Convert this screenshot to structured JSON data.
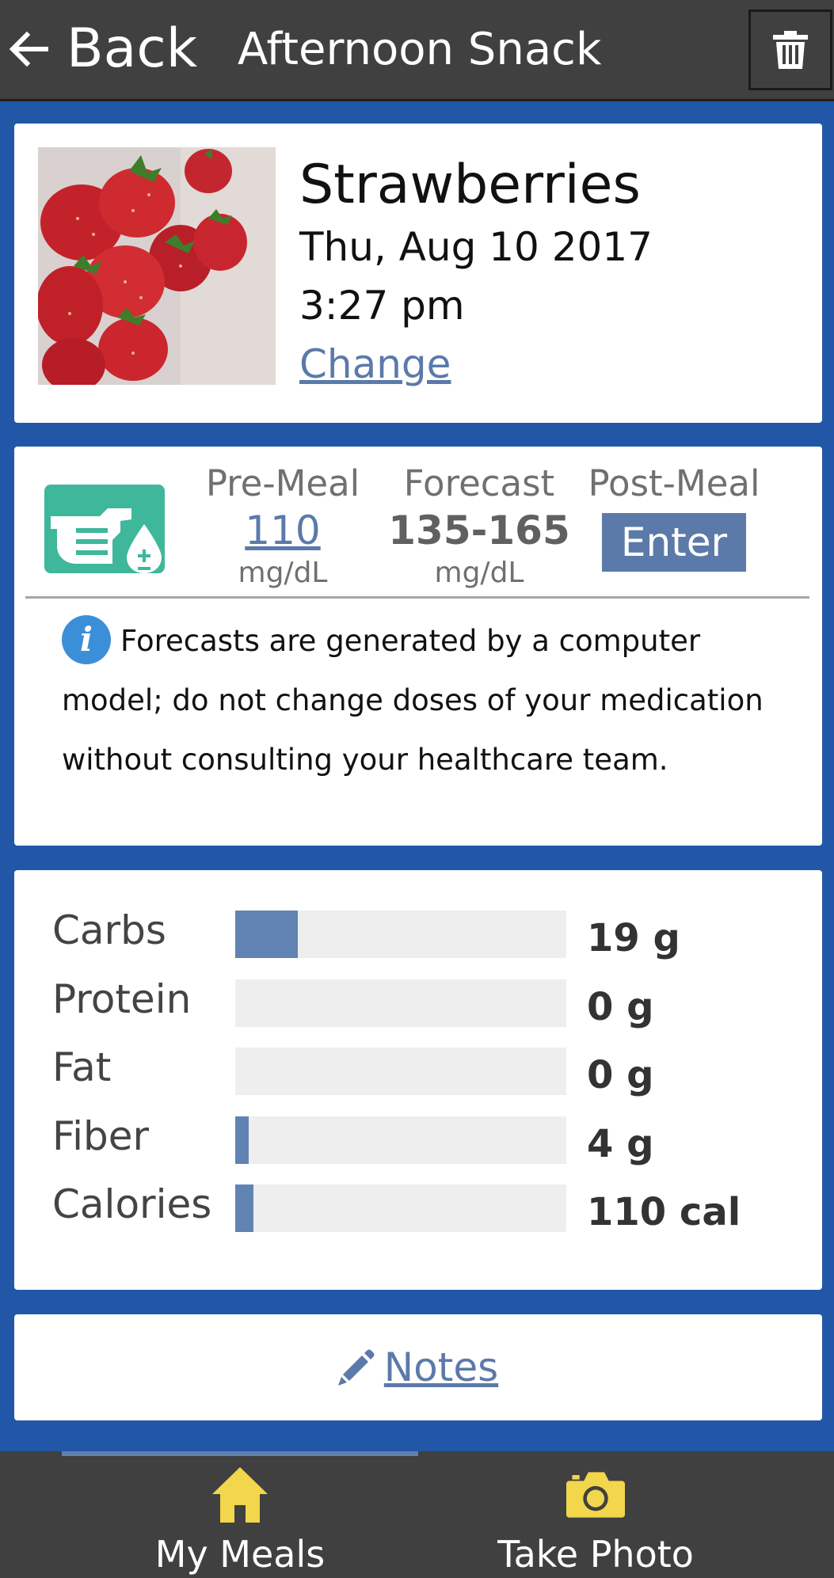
{
  "header": {
    "back_label": "Back",
    "title": "Afternoon Snack",
    "back_icon": "arrow-left-icon",
    "delete_icon": "trash-icon"
  },
  "meal": {
    "name": "Strawberries",
    "date": "Thu, Aug 10 2017",
    "time": "3:27 pm",
    "change_label": "Change",
    "photo_subject": "strawberries"
  },
  "forecast": {
    "icon": "glucose-meter-icon",
    "pre_meal": {
      "label": "Pre-Meal",
      "value": "110",
      "unit": "mg/dL"
    },
    "forecast": {
      "label": "Forecast",
      "value": "135-165",
      "unit": "mg/dL"
    },
    "post_meal": {
      "label": "Post-Meal",
      "button_label": "Enter"
    },
    "info_text": "Forecasts are generated by a computer model; do not change doses of your medication without consulting your healthcare team.",
    "info_icon_glyph": "i"
  },
  "nutrition": {
    "bar_color": "#6083b3",
    "rows": [
      {
        "label": "Carbs",
        "value": "19 g",
        "fraction": 0.19
      },
      {
        "label": "Protein",
        "value": "0 g",
        "fraction": 0
      },
      {
        "label": "Fat",
        "value": "0 g",
        "fraction": 0
      },
      {
        "label": "Fiber",
        "value": "4 g",
        "fraction": 0.04
      },
      {
        "label": "Calories",
        "value": "110 cal",
        "fraction": 0.055
      }
    ]
  },
  "notes": {
    "label": "Notes",
    "icon": "pencil-icon"
  },
  "bottom_nav": {
    "tabs": [
      {
        "label": "My Meals",
        "icon": "home-icon",
        "active": true
      },
      {
        "label": "Take Photo",
        "icon": "camera-icon",
        "active": false
      }
    ]
  },
  "colors": {
    "background": "#2257a8",
    "bars": "#404040",
    "link": "#5b7aaa",
    "accent_icon": "#f2d64b",
    "meter_icon": "#3fb79b"
  }
}
